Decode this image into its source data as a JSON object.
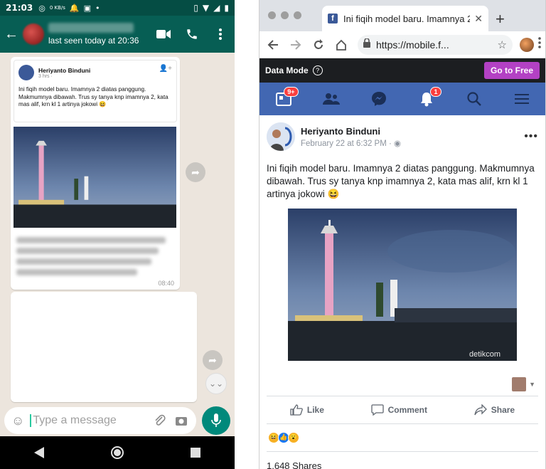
{
  "whatsapp": {
    "status_time": "21:03",
    "status_speed": "0 KB/s",
    "last_seen": "last seen today at 20:36",
    "shared_card": {
      "author": "Heriyanto Binduni",
      "time": "3 hrs · ",
      "text": "Ini fiqih model baru. Imamnya 2 diatas panggung. Makmumnya dibawah. Trus sy tanya knp imamnya 2, kata mas alif, krn kl 1 artinya jokowi 😆"
    },
    "message_time": "08:40",
    "input_placeholder": "Type a message"
  },
  "browser": {
    "tab_title": "Ini fiqih model baru. Imamnya 2 diatas",
    "url": "https://mobile.f..."
  },
  "facebook": {
    "data_mode_label": "Data Mode",
    "go_free_label": "Go to Free",
    "badges": {
      "feed": "9+",
      "notifications": "1"
    },
    "post": {
      "author": "Heriyanto Binduni",
      "time": "February 22 at 6:32 PM · ",
      "text": "Ini fiqih model baru. Imamnya 2 diatas panggung. Makmumnya dibawah. Trus sy tanya knp imamnya 2, kata mas alif, krn kl 1 artinya jokowi 😆",
      "photo_watermark": "detikcom",
      "like_label": "Like",
      "comment_label": "Comment",
      "share_label": "Share",
      "shares_count": "1,648 Shares"
    }
  },
  "colors": {
    "wa_header": "#075e54",
    "wa_mic": "#00897b",
    "fb_nav": "#4267b2",
    "go_free": "#b341c4"
  }
}
